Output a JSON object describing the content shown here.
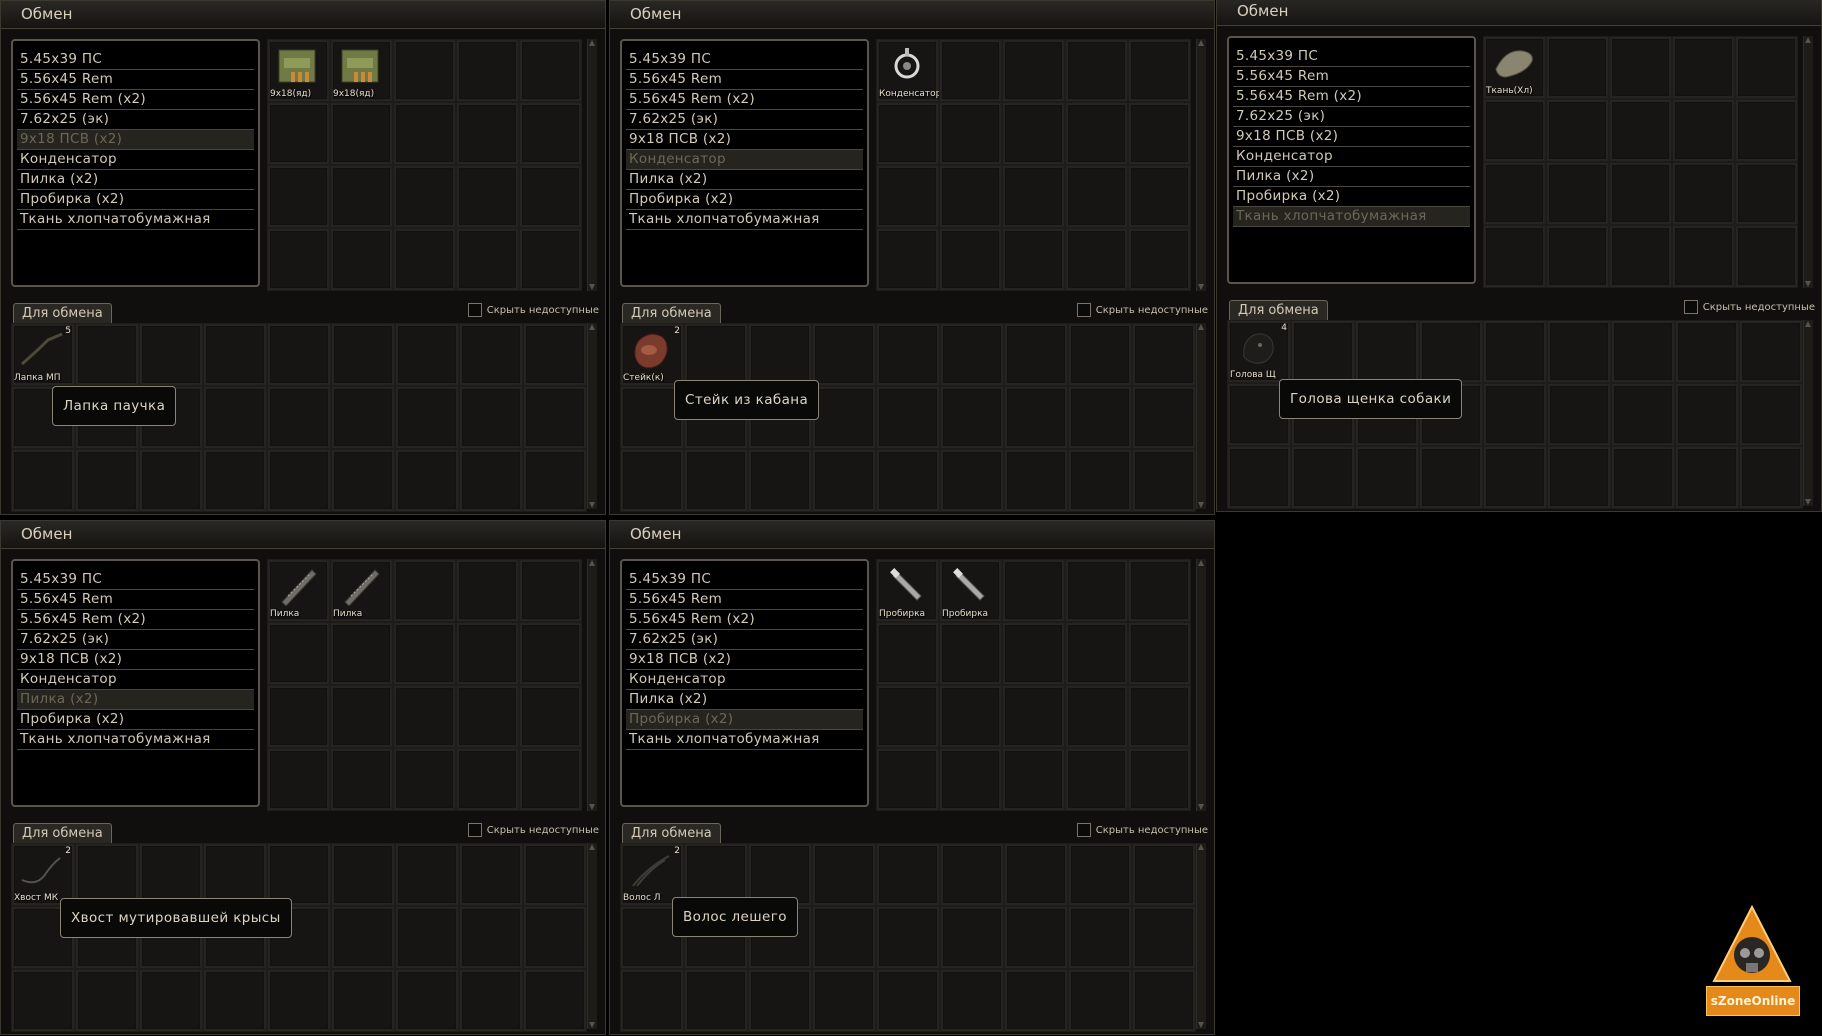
{
  "common": {
    "panel_title": "Обмен",
    "exchange_tab": "Для обмена",
    "hide_unavailable": "Скрыть недоступные"
  },
  "panels": [
    {
      "list": [
        "5.45x39 ПС",
        "5.56x45 Rem",
        "5.56x45 Rem (x2)",
        "7.62x25 (эк)",
        "9x18 ПСВ (x2)",
        "Конденсатор",
        "Пилка (x2)",
        "Пробирка (x2)",
        "Ткань хлопчатобумажная"
      ],
      "selected": 4,
      "reward_items": [
        {
          "label": "9x18(яд)",
          "icon": "ammo-box-icon"
        },
        {
          "label": "9x18(яд)",
          "icon": "ammo-box-icon"
        }
      ],
      "exchange_item": {
        "label": "Лапка МП",
        "count": "5",
        "icon": "spider-leg-icon"
      },
      "tooltip": "Лапка паучка"
    },
    {
      "list": [
        "5.45x39 ПС",
        "5.56x45 Rem",
        "5.56x45 Rem (x2)",
        "7.62x25 (эк)",
        "9x18 ПСВ (x2)",
        "Конденсатор",
        "Пилка (x2)",
        "Пробирка (x2)",
        "Ткань хлопчатобумажная"
      ],
      "selected": 5,
      "reward_items": [
        {
          "label": "Конденсатор",
          "icon": "capacitor-icon"
        }
      ],
      "exchange_item": {
        "label": "Стейк(к)",
        "count": "2",
        "icon": "steak-icon"
      },
      "tooltip": "Стейк из кабана"
    },
    {
      "list": [
        "5.45x39 ПС",
        "5.56x45 Rem",
        "5.56x45 Rem (x2)",
        "7.62x25 (эк)",
        "9x18 ПСВ (x2)",
        "Конденсатор",
        "Пилка (x2)",
        "Пробирка (x2)",
        "Ткань хлопчатобумажная"
      ],
      "selected": 8,
      "reward_items": [
        {
          "label": "Ткань(Хл)",
          "icon": "cloth-icon"
        }
      ],
      "exchange_item": {
        "label": "Голова Щ",
        "count": "4",
        "icon": "dog-head-icon"
      },
      "tooltip": "Голова щенка собаки"
    },
    {
      "list": [
        "5.45x39 ПС",
        "5.56x45 Rem",
        "5.56x45 Rem (x2)",
        "7.62x25 (эк)",
        "9x18 ПСВ (x2)",
        "Конденсатор",
        "Пилка (x2)",
        "Пробирка (x2)",
        "Ткань хлопчатобумажная"
      ],
      "selected": 6,
      "reward_items": [
        {
          "label": "Пилка",
          "icon": "file-saw-icon"
        },
        {
          "label": "Пилка",
          "icon": "file-saw-icon"
        }
      ],
      "exchange_item": {
        "label": "Хвост МК",
        "count": "2",
        "icon": "rat-tail-icon"
      },
      "tooltip": "Хвост мутировавшей крысы"
    },
    {
      "list": [
        "5.45x39 ПС",
        "5.56x45 Rem",
        "5.56x45 Rem (x2)",
        "7.62x25 (эк)",
        "9x18 ПСВ (x2)",
        "Конденсатор",
        "Пилка (x2)",
        "Пробирка (x2)",
        "Ткань хлопчатобумажная"
      ],
      "selected": 7,
      "reward_items": [
        {
          "label": "Пробирка",
          "icon": "test-tube-icon"
        },
        {
          "label": "Пробирка",
          "icon": "test-tube-icon"
        }
      ],
      "exchange_item": {
        "label": "Волос Л",
        "count": "2",
        "icon": "hair-icon"
      },
      "tooltip": "Волос лешего"
    }
  ],
  "logo": {
    "text": "sZoneOnline",
    "icon": "biohazard-mask-logo-icon"
  },
  "colors": {
    "background": "#000000",
    "panel": "#100f0d",
    "selected_row": "#26241f",
    "accent": "#e58a1a"
  }
}
